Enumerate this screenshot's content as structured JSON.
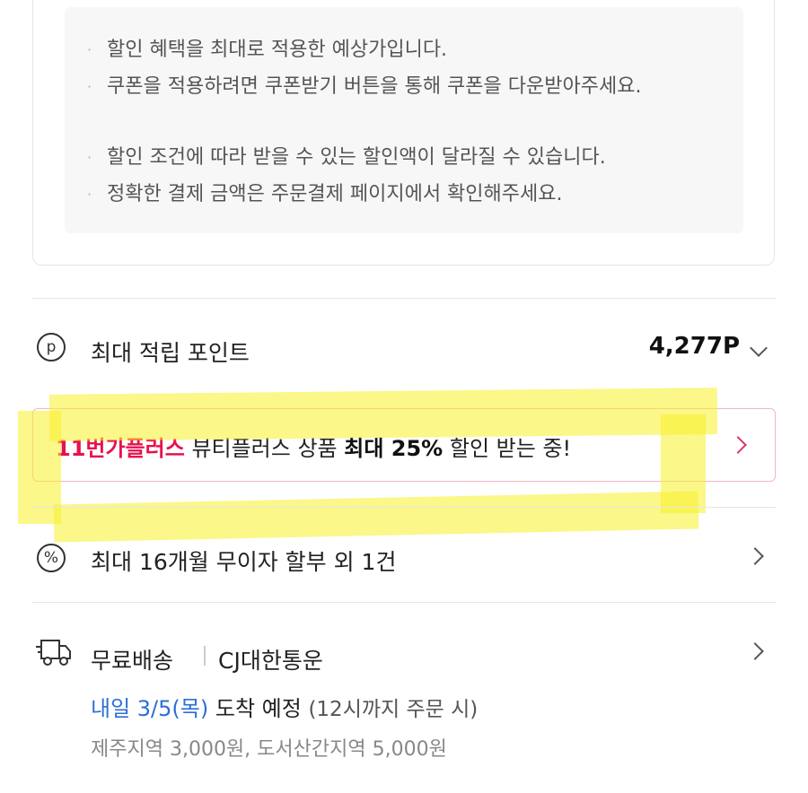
{
  "notices": [
    "할인 혜택을 최대로 적용한 예상가입니다.",
    "쿠폰을 적용하려면 쿠폰받기 버튼을 통해 쿠폰을 다운받아주세요.",
    "할인 조건에 따라 받을 수 있는 할인액이 달라질 수 있습니다.",
    "정확한 결제 금액은 주문결제 페이지에서 확인해주세요."
  ],
  "bullet": "·",
  "points": {
    "icon": "point-circle-icon",
    "icon_glyph": "p",
    "label": "최대 적립 포인트",
    "value": "4,277P"
  },
  "plus_banner": {
    "brand": "11번가플러스",
    "text_1": " 뷰티플러스 상품 ",
    "bold": "최대 25%",
    "text_2": " 할인 받는 중!",
    "brand_color": "#e8114d",
    "border_color": "#f2b5c7"
  },
  "installment": {
    "icon": "percent-circle-icon",
    "icon_glyph": "%",
    "label": "최대 16개월 무이자 할부 외 1건"
  },
  "shipping": {
    "icon": "delivery-truck-icon",
    "label": "무료배송",
    "carrier": "CJ대한통운",
    "arrival_date": "내일 3/5(목)",
    "arrival_text": " 도착 예정 ",
    "arrival_condition": "(12시까지 주문 시)",
    "fees": "제주지역 3,000원, 도서산간지역 5,000원",
    "accent_color": "#2c6fd6"
  },
  "highlight_color": "#f7f028"
}
